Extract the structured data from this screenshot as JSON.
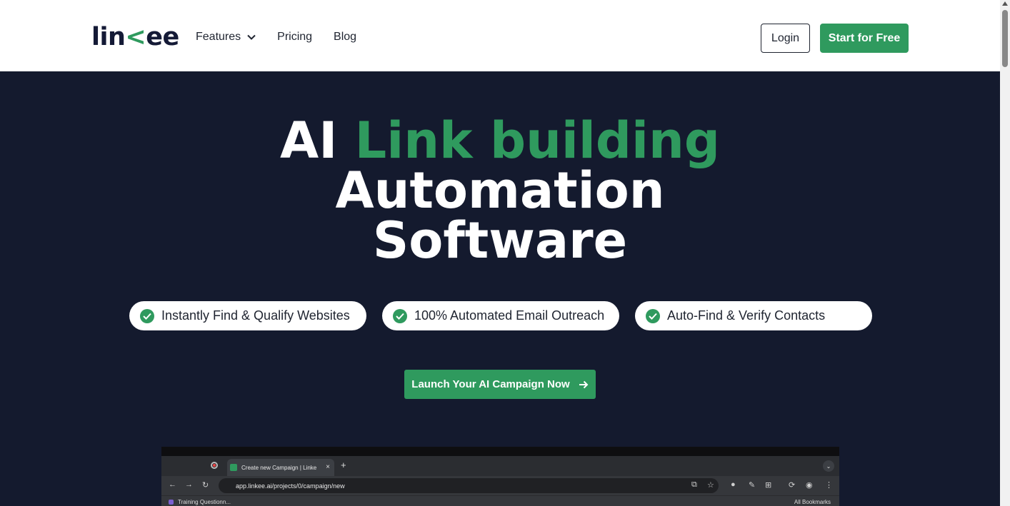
{
  "header": {
    "logo_pre": "lin",
    "logo_chev": "<",
    "logo_post": "ee",
    "nav": {
      "features": "Features",
      "pricing": "Pricing",
      "blog": "Blog"
    },
    "login_label": "Login",
    "start_label": "Start for Free"
  },
  "hero": {
    "headline_part1": "AI ",
    "headline_green": "Link building",
    "headline_line2": "Automation",
    "headline_line3": "Software",
    "features": [
      "Instantly Find & Qualify Websites",
      "100% Automated Email Outreach",
      "Auto-Find & Verify Contacts"
    ],
    "cta_label": "Launch Your AI Campaign Now"
  },
  "browser_preview": {
    "tab_title": "Create new Campaign | Linke",
    "tab_close": "×",
    "new_tab": "+",
    "url": "app.linkee.ai/projects/0/campaign/new",
    "bookmark_left": "Training Questionn...",
    "bookmark_right": "All Bookmarks"
  },
  "colors": {
    "brand_green": "#2f9a5e",
    "hero_bg": "#141a2e",
    "logo_text": "#141a36"
  },
  "icons": [
    "chevron-down-icon",
    "check-circle-icon",
    "arrow-right-icon"
  ]
}
